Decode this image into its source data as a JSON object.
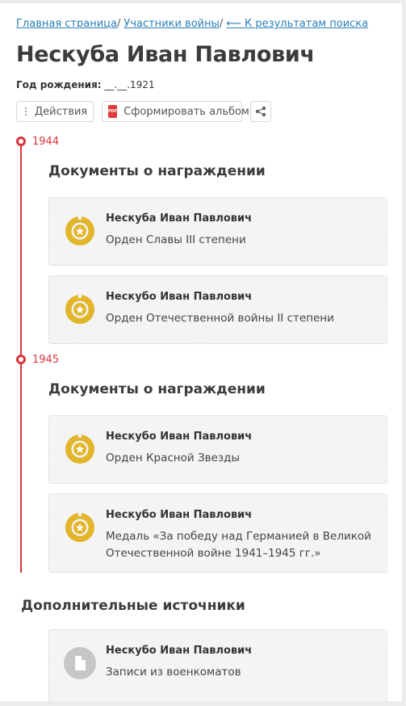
{
  "breadcrumb": {
    "home": "Главная страница",
    "participants": "Участники войны",
    "back": "⟵ К результатам поиска"
  },
  "person": {
    "name": "Нескуба Иван Павлович",
    "birth_label": "Год рождения:",
    "birth_value": "__.__.1921"
  },
  "toolbar": {
    "actions_label": "Действия",
    "album_label": "Сформировать альбом",
    "pdf_icon_text": "PDF",
    "share_icon": "share-icon"
  },
  "timeline": [
    {
      "year": "1944",
      "section_title": "Документы о награждении",
      "cards": [
        {
          "name": "Нескуба Иван Павлович",
          "desc": "Орден Славы III степени",
          "icon": "medal-icon"
        },
        {
          "name": "Нескубо Иван Павлович",
          "desc": "Орден Отечественной войны II степени",
          "icon": "medal-icon"
        }
      ]
    },
    {
      "year": "1945",
      "section_title": "Документы о награждении",
      "cards": [
        {
          "name": "Нескубо Иван Павлович",
          "desc": "Орден Красной Звезды",
          "icon": "medal-icon"
        },
        {
          "name": "Нескубо Иван Павлович",
          "desc": "Медаль «За победу над Германией в Великой Отечественной войне 1941–1945 гг.»",
          "icon": "medal-icon"
        }
      ]
    }
  ],
  "additional": {
    "title": "Дополнительные источники",
    "cards": [
      {
        "name": "Нескубо Иван Павлович",
        "desc": "Записи из военкоматов",
        "icon": "document-icon"
      }
    ]
  },
  "colors": {
    "accent": "#d9363e",
    "link": "#2a7fb8",
    "medal": "#e2b52b",
    "card_bg": "#f4f4f4"
  }
}
